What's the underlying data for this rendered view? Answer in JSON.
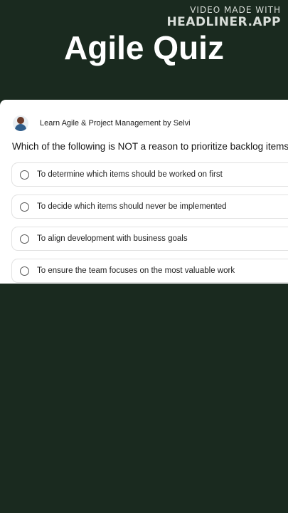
{
  "watermark": {
    "line1": "VIDEO MADE WITH",
    "line2": "HEADLINER.APP"
  },
  "title": "Agile Quiz",
  "card": {
    "channel_name": "Learn Agile & Project Management by Selvi",
    "avatar_icon": "person-avatar",
    "question": "Which of the following is NOT a reason to prioritize backlog items?",
    "options": [
      {
        "label": "To determine which items should be worked on first",
        "selected": false
      },
      {
        "label": "To decide which items should never be implemented",
        "selected": false
      },
      {
        "label": "To align development with business goals",
        "selected": false
      },
      {
        "label": "To ensure the team focuses on the most valuable work",
        "selected": false
      }
    ]
  },
  "colors": {
    "background": "#1a2a1f",
    "card": "#ffffff",
    "title_text": "#ffffff"
  }
}
